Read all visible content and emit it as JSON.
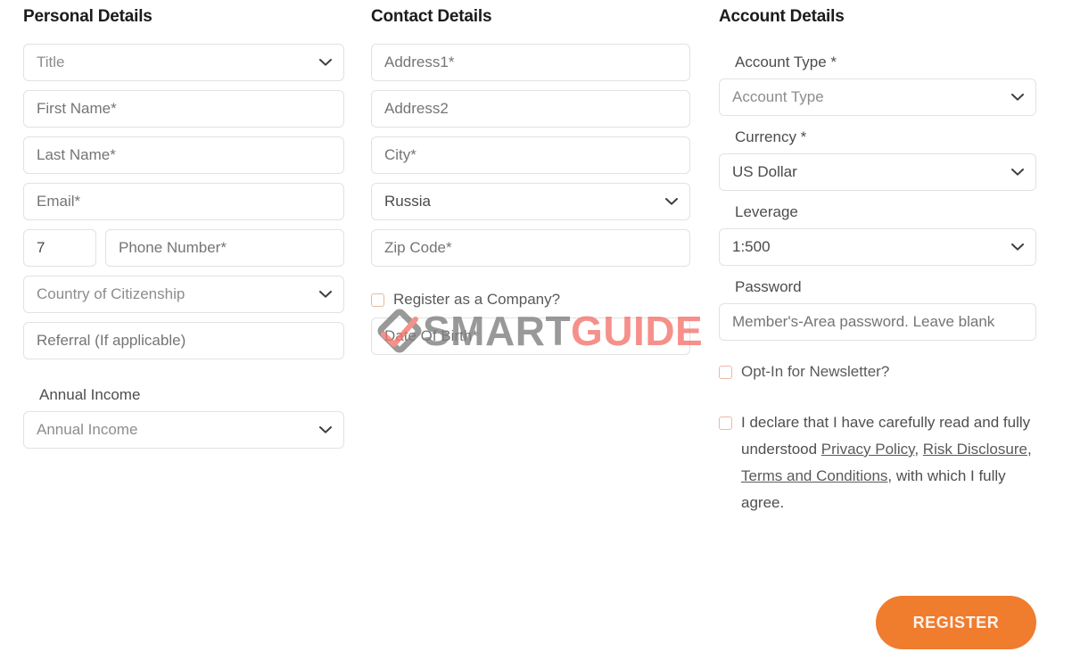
{
  "columns": {
    "personal": {
      "title": "Personal Details",
      "fields": {
        "title_select": {
          "value": "Title",
          "type": "select"
        },
        "first_name": {
          "placeholder": "First Name*"
        },
        "last_name": {
          "placeholder": "Last Name*"
        },
        "email": {
          "placeholder": "Email*"
        },
        "phone_prefix": {
          "value": "7"
        },
        "phone_number": {
          "placeholder": "Phone Number*"
        },
        "country_citizenship": {
          "value": "Country of Citizenship",
          "type": "select"
        },
        "referral": {
          "placeholder": "Referral (If applicable)"
        },
        "annual_income_label": "Annual Income",
        "annual_income": {
          "value": "Annual Income",
          "type": "select"
        }
      }
    },
    "contact": {
      "title": "Contact Details",
      "fields": {
        "address1": {
          "placeholder": "Address1*"
        },
        "address2": {
          "placeholder": "Address2"
        },
        "city": {
          "placeholder": "City*"
        },
        "country": {
          "value": "Russia",
          "type": "select"
        },
        "zip_code": {
          "placeholder": "Zip Code*"
        },
        "register_company_label": "Register as a Company?",
        "date_of_birth": {
          "placeholder": "Date Of Birth*"
        }
      }
    },
    "account": {
      "title": "Account Details",
      "fields": {
        "account_type_label": "Account Type *",
        "account_type": {
          "value": "Account Type",
          "type": "select"
        },
        "currency_label": "Currency *",
        "currency": {
          "value": "US Dollar",
          "type": "select"
        },
        "leverage_label": "Leverage",
        "leverage": {
          "value": "1:500",
          "type": "select"
        },
        "password_label": "Password",
        "password": {
          "placeholder": "Member's-Area password. Leave blank"
        },
        "newsletter_label": "Opt-In for Newsletter?",
        "declaration": {
          "part1": "I declare that I have carefully read and fully understood ",
          "link1": "Privacy Policy",
          "sep1": ", ",
          "link2": "Risk Disclosure",
          "sep2": ", ",
          "link3": "Terms and Conditions",
          "part2": ", with which I fully agree."
        }
      }
    }
  },
  "submit": {
    "register_label": "REGISTER"
  },
  "watermark": {
    "text_primary": "SMART",
    "text_secondary": "GUIDE"
  },
  "colors": {
    "accent_orange": "#f07c2e",
    "watermark_gray": "#7d7d7d",
    "watermark_salmon": "#f4726a",
    "checkbox_border": "#e8b99b",
    "field_border": "#e2e2e2",
    "placeholder": "#8d8d8d"
  }
}
